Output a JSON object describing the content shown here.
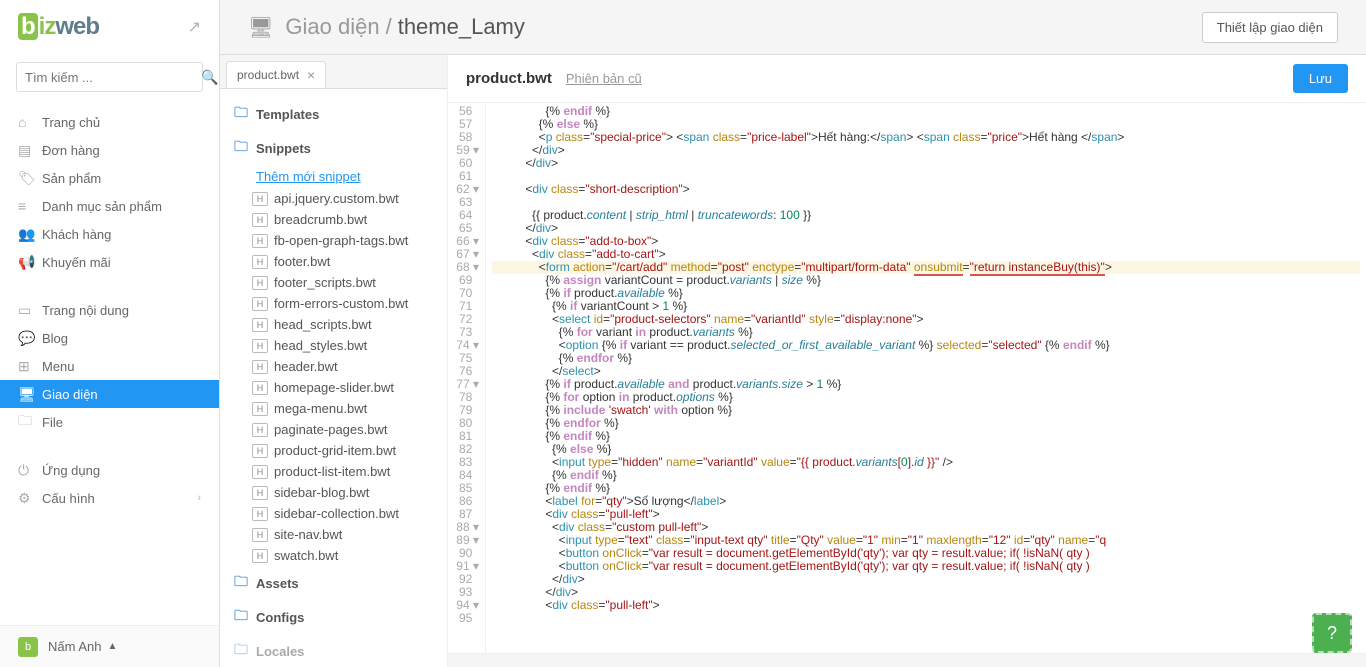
{
  "search": {
    "placeholder": "Tìm kiếm ..."
  },
  "nav": {
    "home": "Trang chủ",
    "orders": "Đơn hàng",
    "products": "Sản phẩm",
    "catalog": "Danh mục sản phẩm",
    "customers": "Khách hàng",
    "promotions": "Khuyến mãi",
    "pages": "Trang nội dung",
    "blog": "Blog",
    "menu": "Menu",
    "theme": "Giao diện",
    "file": "File",
    "apps": "Ứng dụng",
    "config": "Cấu hình"
  },
  "user": {
    "name": "Nấm Anh"
  },
  "breadcrumb": {
    "link": "Giao diện",
    "sep": "/",
    "current": "theme_Lamy"
  },
  "header": {
    "setup_btn": "Thiết lập giao diện"
  },
  "tab": {
    "label": "product.bwt"
  },
  "tree": {
    "folders": {
      "templates": "Templates",
      "snippets": "Snippets",
      "assets": "Assets",
      "configs": "Configs",
      "locales": "Locales"
    },
    "add_snippet": "Thêm mới snippet",
    "files": [
      "api.jquery.custom.bwt",
      "breadcrumb.bwt",
      "fb-open-graph-tags.bwt",
      "footer.bwt",
      "footer_scripts.bwt",
      "form-errors-custom.bwt",
      "head_scripts.bwt",
      "head_styles.bwt",
      "header.bwt",
      "homepage-slider.bwt",
      "mega-menu.bwt",
      "paginate-pages.bwt",
      "product-grid-item.bwt",
      "product-list-item.bwt",
      "sidebar-blog.bwt",
      "sidebar-collection.bwt",
      "site-nav.bwt",
      "swatch.bwt"
    ]
  },
  "editor": {
    "filename": "product.bwt",
    "old_version": "Phiên bản cũ",
    "save": "Lưu",
    "first_line": 56,
    "last_line": 95
  }
}
